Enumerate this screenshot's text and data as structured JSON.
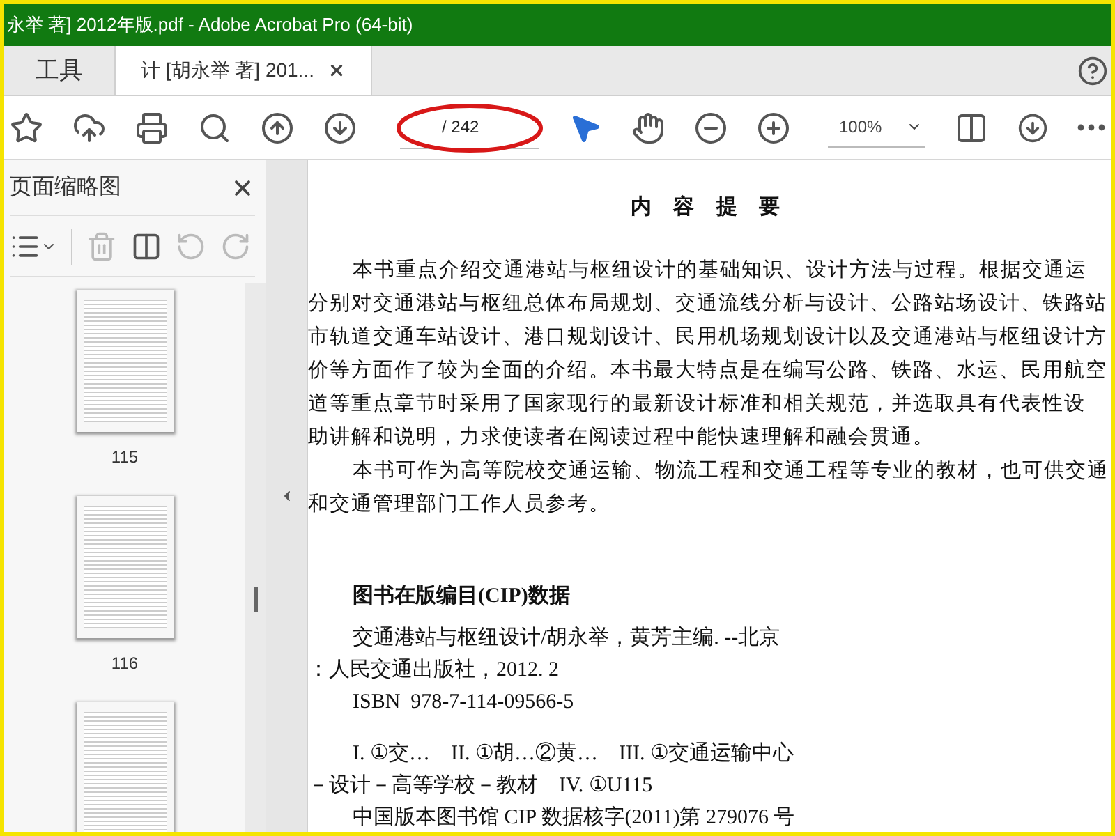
{
  "window": {
    "title": "永举 著] 2012年版.pdf - Adobe Acrobat Pro (64-bit)"
  },
  "tabs": [
    {
      "kind": "home",
      "label": "工具",
      "selected": false
    },
    {
      "kind": "document",
      "label": "计 [胡永举 著] 201...",
      "selected": true
    }
  ],
  "toolbar": {
    "page_total": "/ 242",
    "page_field_circled": true,
    "zoom": "100%"
  },
  "sidebar": {
    "title": "页面缩略图",
    "thumbnails": [
      {
        "label": "115"
      },
      {
        "label": "116"
      }
    ],
    "partial_thumbnail": true
  },
  "document": {
    "heading": "内 容 提 要",
    "summary_lines": [
      {
        "text": "本书重点介绍交通港站与枢纽设计的基础知识、设计方法与过程。根据交通运",
        "indent": true
      },
      {
        "text": "分别对交通港站与枢纽总体布局规划、交通流线分析与设计、公路站场设计、铁路站",
        "indent": false
      },
      {
        "text": "市轨道交通车站设计、港口规划设计、民用机场规划设计以及交通港站与枢纽设计方",
        "indent": false
      },
      {
        "text": "价等方面作了较为全面的介绍。本书最大特点是在编写公路、铁路、水运、民用航空",
        "indent": false
      },
      {
        "text": "道等重点章节时采用了国家现行的最新设计标准和相关规范，并选取具有代表性设",
        "indent": false
      },
      {
        "text": "助讲解和说明，力求使读者在阅读过程中能快速理解和融会贯通。",
        "indent": false
      },
      {
        "text": "本书可作为高等院校交通运输、物流工程和交通工程等专业的教材，也可供交通",
        "indent": true
      },
      {
        "text": "和交通管理部门工作人员参考。",
        "indent": false
      }
    ],
    "cip_heading": "图书在版编目(CIP)数据",
    "cip_groups": [
      [
        {
          "text": "交通港站与枢纽设计/胡永举，黄芳主编. --北京",
          "indent": true
        },
        {
          "text": "：人民交通出版社，2012. 2",
          "indent": false
        },
        {
          "text": "ISBN  978-7-114-09566-5",
          "indent": true
        }
      ],
      [
        {
          "text": "I. ①交…    II. ①胡…②黄…    III. ①交通运输中心",
          "indent": true
        },
        {
          "text": "－设计－高等学校－教材    IV. ①U115",
          "indent": false
        },
        {
          "text": "中国版本图书馆 CIP 数据核字(2011)第 279076 号",
          "indent": true
        }
      ]
    ]
  }
}
